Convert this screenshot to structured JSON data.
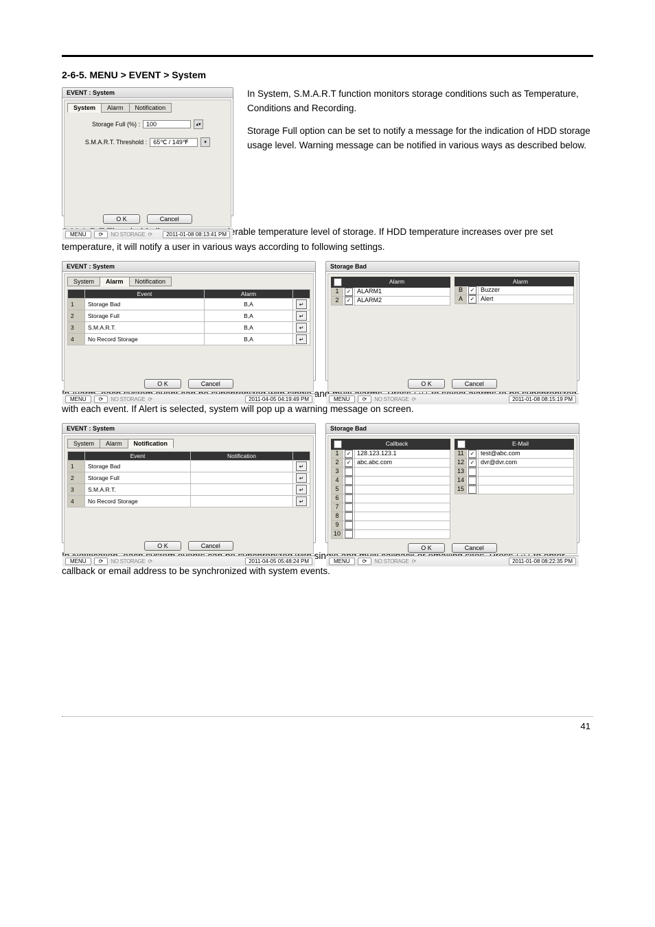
{
  "heading": "2-6-5. MENU > EVENT > System",
  "intro_right_p1": "In System, S.M.A.R.T function monitors storage conditions such as Temperature, Conditions and Recording.",
  "intro_right_p2": "Storage Full option can be set to notify a message for the indication of HDD storage usage level. Warning message can be notified in various ways as described below.",
  "para_smart": "S.M.A.R.T Threshold allows to pre set tolerable temperature level of storage. If HDD temperature increases over pre set temperature, it will notify a user in various ways according to following settings.",
  "para_alarm_pre": "In Alarm, each system event can be synchronized with single and multi alarms. Press ",
  "para_alarm_post": " to select alarms to be synchronized with each event. If Alert is selected, system will pop up a warning message on screen.",
  "para_notify_pre": "In Notification, each system events can be synchronized with single and multi callback or emailing sites. Press ",
  "para_notify_post": " to enter callback or email address to be synchronized with system events.",
  "common": {
    "menu": "MENU",
    "ok": "O K",
    "cancel": "Cancel",
    "no_storage": "NO STORAGE"
  },
  "shot_system": {
    "title": "EVENT : System",
    "tabs": [
      "System",
      "Alarm",
      "Notification"
    ],
    "active_tab": 0,
    "storage_label": "Storage Full (%) :",
    "storage_value": "100",
    "smart_label": "S.M.A.R.T. Threshold :",
    "smart_value": "65℃ / 149℉",
    "timestamp": "2011-01-08 08:13:41 PM"
  },
  "shot_alarm": {
    "title": "EVENT : System",
    "tabs": [
      "System",
      "Alarm",
      "Notification"
    ],
    "active_tab": 1,
    "cols": [
      "Event",
      "Alarm"
    ],
    "rows": [
      {
        "n": "1",
        "event": "Storage Bad",
        "alarm": "B,A"
      },
      {
        "n": "2",
        "event": "Storage Full",
        "alarm": "B,A"
      },
      {
        "n": "3",
        "event": "S.M.A.R.T.",
        "alarm": "B,A"
      },
      {
        "n": "4",
        "event": "No Record Storage",
        "alarm": "B,A"
      }
    ],
    "timestamp": "2011-04-05 04:19:49 PM"
  },
  "shot_storage_alarm": {
    "title": "Storage Bad",
    "col_label": "Alarm",
    "left": [
      {
        "n": "1",
        "checked": true,
        "label": "ALARM1"
      },
      {
        "n": "2",
        "checked": true,
        "label": "ALARM2"
      }
    ],
    "right": [
      {
        "n": "B",
        "checked": true,
        "label": "Buzzer"
      },
      {
        "n": "A",
        "checked": true,
        "label": "Alert"
      }
    ],
    "timestamp": "2011-01-08 08:15:19 PM"
  },
  "shot_notify": {
    "title": "EVENT : System",
    "tabs": [
      "System",
      "Alarm",
      "Notification"
    ],
    "active_tab": 2,
    "cols": [
      "Event",
      "Notification"
    ],
    "rows": [
      {
        "n": "1",
        "event": "Storage Bad"
      },
      {
        "n": "2",
        "event": "Storage Full"
      },
      {
        "n": "3",
        "event": "S.M.A.R.T."
      },
      {
        "n": "4",
        "event": "No Record Storage"
      }
    ],
    "timestamp": "2011-04-05 05:48:24 PM"
  },
  "shot_storage_notify": {
    "title": "Storage Bad",
    "callback_label": "Callback",
    "email_label": "E-Mail",
    "callback": [
      {
        "n": "1",
        "checked": true,
        "value": "128.123.123.1"
      },
      {
        "n": "2",
        "checked": true,
        "value": "abc.abc.com"
      },
      {
        "n": "3",
        "checked": false,
        "value": ""
      },
      {
        "n": "4",
        "checked": false,
        "value": ""
      },
      {
        "n": "5",
        "checked": false,
        "value": ""
      },
      {
        "n": "6",
        "checked": false,
        "value": ""
      },
      {
        "n": "7",
        "checked": false,
        "value": ""
      },
      {
        "n": "8",
        "checked": false,
        "value": ""
      },
      {
        "n": "9",
        "checked": false,
        "value": ""
      },
      {
        "n": "10",
        "checked": false,
        "value": ""
      }
    ],
    "email": [
      {
        "n": "11",
        "checked": true,
        "value": "test@abc.com"
      },
      {
        "n": "12",
        "checked": true,
        "value": "dvr@dvr.com"
      },
      {
        "n": "13",
        "checked": false,
        "value": ""
      },
      {
        "n": "14",
        "checked": false,
        "value": ""
      },
      {
        "n": "15",
        "checked": false,
        "value": ""
      }
    ],
    "timestamp": "2011-01-08 08:22:35 PM"
  },
  "page_number": "41"
}
